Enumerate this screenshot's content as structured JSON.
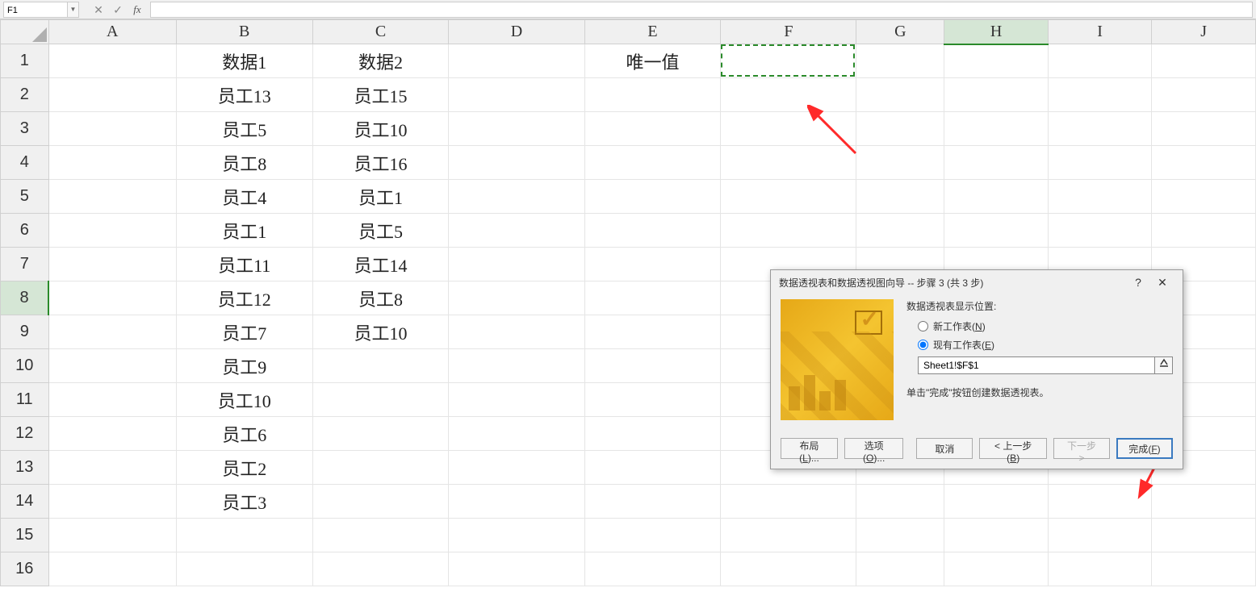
{
  "formula_bar": {
    "cell_ref": "F1",
    "formula_text": ""
  },
  "columns": [
    "A",
    "B",
    "C",
    "D",
    "E",
    "F",
    "G",
    "H",
    "I",
    "J"
  ],
  "rows": [
    1,
    2,
    3,
    4,
    5,
    6,
    7,
    8,
    9,
    10,
    11,
    12,
    13,
    14,
    15,
    16
  ],
  "active_row": 8,
  "active_col_index": 7,
  "cellData": {
    "1": {
      "B": "数据1",
      "C": "数据2",
      "E": "唯一值"
    },
    "2": {
      "B": "员工13",
      "C": "员工15"
    },
    "3": {
      "B": "员工5",
      "C": "员工10"
    },
    "4": {
      "B": "员工8",
      "C": "员工16"
    },
    "5": {
      "B": "员工4",
      "C": "员工1"
    },
    "6": {
      "B": "员工1",
      "C": "员工5"
    },
    "7": {
      "B": "员工11",
      "C": "员工14"
    },
    "8": {
      "B": "员工12",
      "C": "员工8"
    },
    "9": {
      "B": "员工7",
      "C": "员工10"
    },
    "10": {
      "B": "员工9"
    },
    "11": {
      "B": "员工10"
    },
    "12": {
      "B": "员工6"
    },
    "13": {
      "B": "员工2"
    },
    "14": {
      "B": "员工3"
    }
  },
  "dialog": {
    "title": "数据透视表和数据透视图向导 -- 步骤 3 (共 3 步)",
    "section_label": "数据透视表显示位置:",
    "radio_new": "新工作表",
    "radio_new_key": "N",
    "radio_existing": "现有工作表",
    "radio_existing_key": "E",
    "location_value": "Sheet1!$F$1",
    "hint": "单击\"完成\"按钮创建数据透视表。",
    "btn_layout": "布局(L)...",
    "btn_options": "选项(O)...",
    "btn_cancel": "取消",
    "btn_back": "< 上一步",
    "btn_back_key": "B",
    "btn_next": "下一步 >",
    "btn_finish": "完成",
    "btn_finish_key": "F"
  }
}
